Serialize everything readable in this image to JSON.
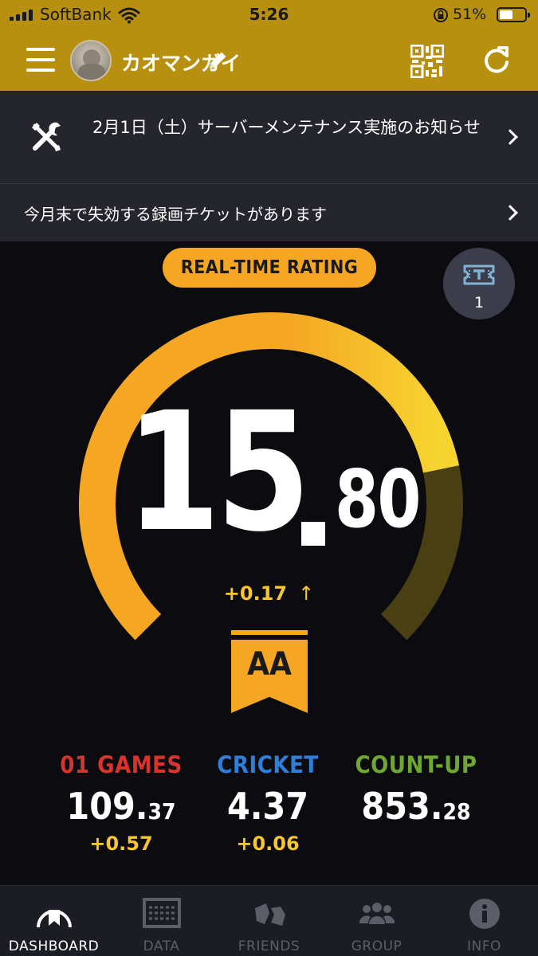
{
  "status_bar": {
    "carrier": "SoftBank",
    "time": "5:26",
    "battery_percent": "51%",
    "icons": [
      "signal-icon",
      "wifi-icon",
      "rotation-lock-icon",
      "battery-icon"
    ]
  },
  "header": {
    "user_name": "カオマンガイ",
    "icons": [
      "menu-icon",
      "avatar",
      "edit-icon",
      "qr-code-icon",
      "refresh-icon"
    ],
    "accent_color": "#b8900f"
  },
  "notices": [
    {
      "text": "2月1日（土）サーバーメンテナンス実施のお知らせ",
      "icon": "wrench-icon"
    },
    {
      "text": "今月末で失効する録画チケットがあります"
    }
  ],
  "rating": {
    "label": "REAL-TIME RATING",
    "integer": "15",
    "decimal": "80",
    "value": 15.8,
    "delta": "+0.17",
    "delta_arrow": "↑",
    "rank": "AA",
    "colors": {
      "arc_orange": "#f5a623",
      "arc_yellow": "#f7d530",
      "arc_dim": "#4a3f12",
      "delta": "#f7c630"
    }
  },
  "ticket": {
    "count": "1",
    "icon": "ticket-icon"
  },
  "stats": [
    {
      "title": "01 GAMES",
      "value_main": "109.",
      "value_small": "37",
      "delta": "+0.57",
      "color": "#d9342b"
    },
    {
      "title": "CRICKET",
      "value_main": "4.37",
      "value_small": "",
      "delta": "+0.06",
      "color": "#2f7fd8"
    },
    {
      "title": "COUNT-UP",
      "value_main": "853.",
      "value_small": "28",
      "delta": "",
      "color": "#6ea832"
    }
  ],
  "nav": [
    {
      "label": "DASHBOARD",
      "icon": "dashboard-icon",
      "active": true
    },
    {
      "label": "DATA",
      "icon": "data-icon",
      "active": false
    },
    {
      "label": "FRIENDS",
      "icon": "friends-icon",
      "active": false
    },
    {
      "label": "GROUP",
      "icon": "group-icon",
      "active": false
    },
    {
      "label": "INFO",
      "icon": "info-icon",
      "active": false
    }
  ]
}
